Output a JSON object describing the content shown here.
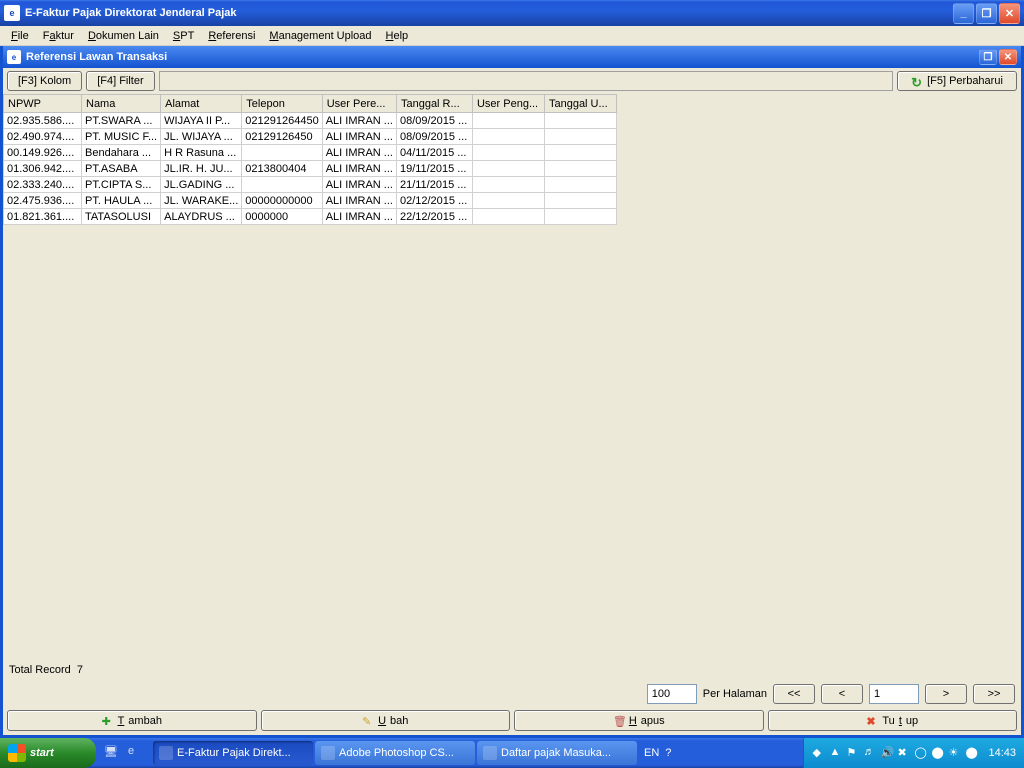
{
  "outer": {
    "title": "E-Faktur Pajak Direktorat Jenderal Pajak"
  },
  "menu": {
    "file": "File",
    "faktur": "Faktur",
    "dokumen": "Dokumen Lain",
    "spt": "SPT",
    "referensi": "Referensi",
    "mgmt": "Management Upload",
    "help": "Help"
  },
  "inner": {
    "title": "Referensi Lawan Transaksi"
  },
  "toolbar": {
    "kolom": "[F3] Kolom",
    "filter": "[F4] Filter",
    "refresh": "[F5] Perbaharui"
  },
  "columns": {
    "npwp": "NPWP",
    "nama": "Nama",
    "alamat": "Alamat",
    "telepon": "Telepon",
    "userp": "User Pere...",
    "tglr": "Tanggal R...",
    "userpg": "User Peng...",
    "tglu": "Tanggal U..."
  },
  "rows": [
    {
      "npwp": "02.935.586....",
      "nama": "PT.SWARA ...",
      "alamat": "WIJAYA II P...",
      "telepon": "021291264450",
      "userp": "ALI IMRAN ...",
      "tglr": "08/09/2015 ...",
      "userpg": "",
      "tglu": ""
    },
    {
      "npwp": "02.490.974....",
      "nama": "PT. MUSIC F...",
      "alamat": "JL. WIJAYA ...",
      "telepon": "02129126450",
      "userp": "ALI IMRAN ...",
      "tglr": "08/09/2015 ...",
      "userpg": "",
      "tglu": ""
    },
    {
      "npwp": "00.149.926....",
      "nama": "Bendahara ...",
      "alamat": "H R Rasuna ...",
      "telepon": "",
      "userp": "ALI IMRAN ...",
      "tglr": "04/11/2015 ...",
      "userpg": "",
      "tglu": ""
    },
    {
      "npwp": "01.306.942....",
      "nama": "PT.ASABA",
      "alamat": "JL.IR. H. JU...",
      "telepon": "0213800404",
      "userp": "ALI IMRAN ...",
      "tglr": "19/11/2015 ...",
      "userpg": "",
      "tglu": ""
    },
    {
      "npwp": "02.333.240....",
      "nama": "PT.CIPTA S...",
      "alamat": "JL.GADING ...",
      "telepon": "",
      "userp": "ALI IMRAN ...",
      "tglr": "21/11/2015 ...",
      "userpg": "",
      "tglu": ""
    },
    {
      "npwp": "02.475.936....",
      "nama": "PT. HAULA ...",
      "alamat": "JL. WARAKE...",
      "telepon": "00000000000",
      "userp": "ALI IMRAN ...",
      "tglr": "02/12/2015 ...",
      "userpg": "",
      "tglu": ""
    },
    {
      "npwp": "01.821.361....",
      "nama": "TATASOLUSI",
      "alamat": "ALAYDRUS ...",
      "telepon": "0000000",
      "userp": "ALI IMRAN ...",
      "tglr": "22/12/2015 ...",
      "userpg": "",
      "tglu": ""
    }
  ],
  "status": {
    "total_label": "Total Record",
    "total_value": "7"
  },
  "pager": {
    "perpage": "100",
    "perpage_label": "Per Halaman",
    "first": "<<",
    "prev": "<",
    "page": "1",
    "next": ">",
    "last": ">>"
  },
  "actions": {
    "tambah": "Tambah",
    "ubah": "Ubah",
    "hapus": "Hapus",
    "tutup": "Tutup"
  },
  "taskbar": {
    "start": "start",
    "tasks": [
      {
        "label": "E-Faktur Pajak Direkt...",
        "active": true
      },
      {
        "label": "Adobe Photoshop CS...",
        "active": false
      },
      {
        "label": "Daftar pajak Masuka...",
        "active": false
      }
    ],
    "lang": "EN",
    "clock": "14:43"
  }
}
